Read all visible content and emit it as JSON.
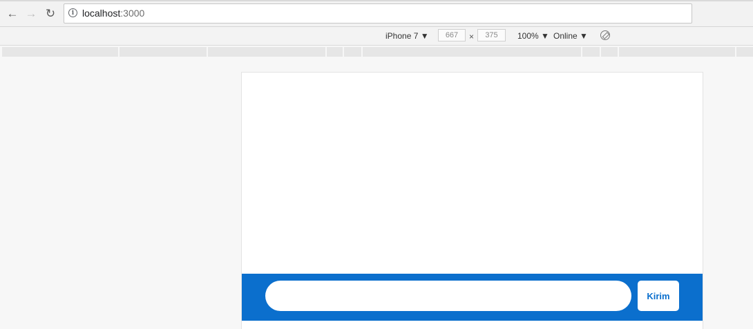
{
  "browser": {
    "back_icon": "←",
    "forward_icon": "→",
    "reload_icon": "↻",
    "info_icon": "i",
    "url_host": "localhost",
    "url_port": ":3000"
  },
  "devtools": {
    "device": "iPhone 7",
    "width": "667",
    "times": "×",
    "height": "375",
    "zoom": "100%",
    "network": "Online",
    "dropdown_arrow": "▼",
    "rotate_icon": "rotate-icon"
  },
  "app": {
    "input_value": "",
    "send_label": "Kirim",
    "accent_color": "#0b6fcd"
  }
}
